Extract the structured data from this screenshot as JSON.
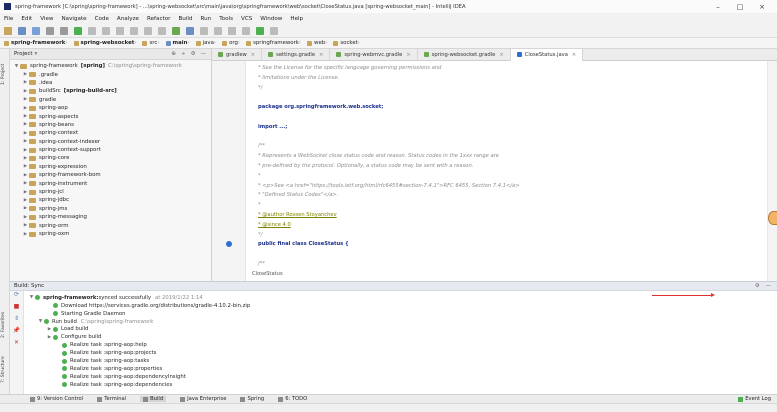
{
  "window": {
    "title": "spring-framework [C:\\spring\\spring-framework] - ...\\spring-websocket\\src\\main\\java\\org\\springframework\\web\\socket\\CloseStatus.java [spring-websocket_main] - IntelliJ IDEA",
    "minimize": "–",
    "maximize": "□",
    "close": "×"
  },
  "menu": [
    "File",
    "Edit",
    "View",
    "Navigate",
    "Code",
    "Analyze",
    "Refactor",
    "Build",
    "Run",
    "Tools",
    "VCS",
    "Window",
    "Help"
  ],
  "navbar": {
    "items": [
      {
        "label": "spring-framework",
        "bold": true
      },
      {
        "label": "spring-websocket",
        "bold": true
      },
      {
        "label": "src",
        "bold": false
      },
      {
        "label": "main",
        "bold": true
      },
      {
        "label": "java",
        "bold": false
      },
      {
        "label": "org",
        "bold": false
      },
      {
        "label": "springframework",
        "bold": false
      },
      {
        "label": "web",
        "bold": false
      },
      {
        "label": "socket",
        "bold": false
      }
    ]
  },
  "tool_stripes_left": [
    "1: Project",
    "2: Favorites",
    "7: Structure"
  ],
  "project_panel": {
    "header": "Project",
    "header_icons": [
      "⚙",
      "⊕",
      "÷",
      "⚙",
      "—"
    ],
    "tree": [
      {
        "indent": 0,
        "arrow": "▼",
        "label": "spring-framework",
        "bold_suffix": "[spring]",
        "gray": "C:\\spring\\spring-framework"
      },
      {
        "indent": 1,
        "arrow": "▶",
        "label": ".gradle",
        "bold_suffix": "",
        "gray": ""
      },
      {
        "indent": 1,
        "arrow": "▶",
        "label": ".idea",
        "bold_suffix": "",
        "gray": ""
      },
      {
        "indent": 1,
        "arrow": "▶",
        "label": "buildSrc",
        "bold_suffix": "[spring-build-src]",
        "gray": ""
      },
      {
        "indent": 1,
        "arrow": "▶",
        "label": "gradle",
        "bold_suffix": "",
        "gray": ""
      },
      {
        "indent": 1,
        "arrow": "▶",
        "label": "spring-aop",
        "bold_suffix": "",
        "gray": ""
      },
      {
        "indent": 1,
        "arrow": "▶",
        "label": "spring-aspects",
        "bold_suffix": "",
        "gray": ""
      },
      {
        "indent": 1,
        "arrow": "▶",
        "label": "spring-beans",
        "bold_suffix": "",
        "gray": ""
      },
      {
        "indent": 1,
        "arrow": "▶",
        "label": "spring-context",
        "bold_suffix": "",
        "gray": ""
      },
      {
        "indent": 1,
        "arrow": "▶",
        "label": "spring-context-indexer",
        "bold_suffix": "",
        "gray": ""
      },
      {
        "indent": 1,
        "arrow": "▶",
        "label": "spring-context-support",
        "bold_suffix": "",
        "gray": ""
      },
      {
        "indent": 1,
        "arrow": "▶",
        "label": "spring-core",
        "bold_suffix": "",
        "gray": ""
      },
      {
        "indent": 1,
        "arrow": "▶",
        "label": "spring-expression",
        "bold_suffix": "",
        "gray": ""
      },
      {
        "indent": 1,
        "arrow": "▶",
        "label": "spring-framework-bom",
        "bold_suffix": "",
        "gray": ""
      },
      {
        "indent": 1,
        "arrow": "▶",
        "label": "spring-instrument",
        "bold_suffix": "",
        "gray": ""
      },
      {
        "indent": 1,
        "arrow": "▶",
        "label": "spring-jcl",
        "bold_suffix": "",
        "gray": ""
      },
      {
        "indent": 1,
        "arrow": "▶",
        "label": "spring-jdbc",
        "bold_suffix": "",
        "gray": ""
      },
      {
        "indent": 1,
        "arrow": "▶",
        "label": "spring-jms",
        "bold_suffix": "",
        "gray": ""
      },
      {
        "indent": 1,
        "arrow": "▶",
        "label": "spring-messaging",
        "bold_suffix": "",
        "gray": ""
      },
      {
        "indent": 1,
        "arrow": "▶",
        "label": "spring-orm",
        "bold_suffix": "",
        "gray": ""
      },
      {
        "indent": 1,
        "arrow": "▶",
        "label": "spring-oxm",
        "bold_suffix": "",
        "gray": ""
      }
    ]
  },
  "editor_tabs": [
    {
      "label": "gradlew",
      "active": false
    },
    {
      "label": "settings.gradle",
      "active": false
    },
    {
      "label": "spring-webmvc.gradle",
      "active": false
    },
    {
      "label": "spring-websocket.gradle",
      "active": false
    },
    {
      "label": "CloseStatus.java",
      "active": true
    }
  ],
  "code_lines": [
    {
      "cls": "cm",
      "text": " * See the License for the specific language governing permissions and"
    },
    {
      "cls": "cm",
      "text": " * limitations under the License."
    },
    {
      "cls": "cm",
      "text": " */"
    },
    {
      "cls": "",
      "text": ""
    },
    {
      "cls": "kw",
      "text": "package org.springframework.web.socket;"
    },
    {
      "cls": "",
      "text": ""
    },
    {
      "cls": "kw",
      "text": "import ...;"
    },
    {
      "cls": "",
      "text": ""
    },
    {
      "cls": "cm",
      "text": "/**"
    },
    {
      "cls": "cm",
      "text": " * Represents a WebSocket close status code and reason. Status codes in the 1xxx range are"
    },
    {
      "cls": "cm",
      "text": " * pre-defined by the protocol. Optionally, a status code may be sent with a reason."
    },
    {
      "cls": "cm",
      "text": " *"
    },
    {
      "cls": "cm",
      "text": " * <p>See <a href=\"https://tools.ietf.org/html/rfc6455#section-7.4.1\">RFC 6455, Section 7.4.1</a>"
    },
    {
      "cls": "cm",
      "text": " * \"Defined Status Codes\"</a>."
    },
    {
      "cls": "cm",
      "text": " *"
    },
    {
      "cls": "ann",
      "text": " * @author Rossen Stoyanchev"
    },
    {
      "cls": "ann",
      "text": " * @since 4.0"
    },
    {
      "cls": "cm",
      "text": " */"
    },
    {
      "cls": "kw",
      "text": "public final class CloseStatus {"
    },
    {
      "cls": "",
      "text": ""
    },
    {
      "cls": "cm",
      "text": "    /**"
    }
  ],
  "editor_footer": "CloseStatus",
  "build": {
    "header": "Build: Sync",
    "lines": [
      {
        "indent": 0,
        "arrow": "▼",
        "bold": "spring-framework:",
        "text": " synced successfully",
        "gray": "at 2019/1/22 1:14",
        "time": ""
      },
      {
        "indent": 2,
        "arrow": "",
        "bold": "",
        "text": "Download https://services.gradle.org/distributions/gradle-4.10.2-bin.zip",
        "gray": "",
        "time": ""
      },
      {
        "indent": 2,
        "arrow": "",
        "bold": "",
        "text": "Starting Gradle Daemon",
        "gray": "",
        "time": ""
      },
      {
        "indent": 1,
        "arrow": "▼",
        "bold": "",
        "text": "Run build",
        "gray": "C:\\spring\\spring-framework",
        "time": ""
      },
      {
        "indent": 2,
        "arrow": "▶",
        "bold": "",
        "text": "Load build",
        "gray": "",
        "time": ""
      },
      {
        "indent": 2,
        "arrow": "▶",
        "bold": "",
        "text": "Configure build",
        "gray": "",
        "time": ""
      },
      {
        "indent": 3,
        "arrow": "",
        "bold": "",
        "text": "Realize task :spring-aop:help",
        "gray": "",
        "time": ""
      },
      {
        "indent": 3,
        "arrow": "",
        "bold": "",
        "text": "Realize task :spring-aop:projects",
        "gray": "",
        "time": ""
      },
      {
        "indent": 3,
        "arrow": "",
        "bold": "",
        "text": "Realize task :spring-aop:tasks",
        "gray": "",
        "time": ""
      },
      {
        "indent": 3,
        "arrow": "",
        "bold": "",
        "text": "Realize task :spring-aop:properties",
        "gray": "",
        "time": ""
      },
      {
        "indent": 3,
        "arrow": "",
        "bold": "",
        "text": "Realize task :spring-aop:dependencyInsight",
        "gray": "",
        "time": ""
      },
      {
        "indent": 3,
        "arrow": "",
        "bold": "",
        "text": "Realize task :spring-aop:dependencies",
        "gray": "",
        "time": ""
      }
    ]
  },
  "bottom_tools": [
    {
      "label": "9: Version Control",
      "active": false
    },
    {
      "label": "Terminal",
      "active": false
    },
    {
      "label": "Build",
      "active": true
    },
    {
      "label": "Java Enterprise",
      "active": false
    },
    {
      "label": "Spring",
      "active": false
    },
    {
      "label": "6: TODO",
      "active": false
    }
  ],
  "event_log": "Event Log",
  "status": {
    "message": "",
    "right": [
      "",
      "",
      "",
      ""
    ]
  },
  "colors": {
    "accent": "#2e6fd0",
    "success": "#4caf50",
    "arrow": "#e03131"
  }
}
